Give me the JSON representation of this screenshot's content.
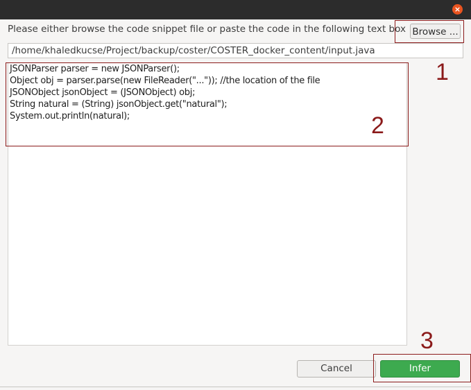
{
  "dialog": {
    "close_glyph": "×",
    "instruction": "Please either browse the code snippet file or paste the code in the following text box",
    "browse_label": "Browse ...",
    "file_path": "/home/khaledkucse/Project/backup/coster/COSTER_docker_content/input.java",
    "code_lines": [
      "JSONParser parser = new JSONParser();",
      "Object obj = parser.parse(new FileReader(\"...\")); //the location of the file",
      "JSONObject jsonObject = (JSONObject) obj;",
      "String natural = (String) jsonObject.get(\"natural\");",
      "System.out.println(natural);"
    ],
    "cancel_label": "Cancel",
    "infer_label": "Infer"
  },
  "annotations": {
    "label_1": "1",
    "label_2": "2",
    "label_3": "3",
    "color": "#8b1a1a"
  },
  "colors": {
    "titlebar": "#2c2c2c",
    "close": "#e95420",
    "infer": "#3daa4f"
  }
}
